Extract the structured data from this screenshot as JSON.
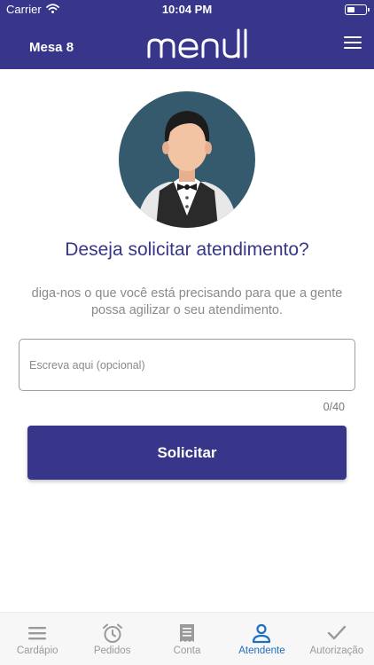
{
  "status_bar": {
    "carrier": "Carrier",
    "time": "10:04 PM"
  },
  "header": {
    "table": "Mesa 8",
    "logo_text": "menu",
    "menu_icon": "hamburger-icon"
  },
  "main": {
    "avatar_icon": "waiter-avatar",
    "title": "Deseja solicitar atendimento?",
    "subtitle": "diga-nos o que você está precisando para que a gente possa agilizar o seu atendimento.",
    "input_placeholder": "Escreva aqui (opcional)",
    "input_value": "",
    "counter": "0/40",
    "submit_label": "Solicitar"
  },
  "tabbar": {
    "active_color": "#1f6fc0",
    "items": [
      {
        "label": "Cardápio",
        "icon": "list-icon"
      },
      {
        "label": "Pedidos",
        "icon": "alarm-clock-icon"
      },
      {
        "label": "Conta",
        "icon": "receipt-icon"
      },
      {
        "label": "Atendente",
        "icon": "person-icon",
        "active": true
      },
      {
        "label": "Autorização",
        "icon": "checkmark-icon"
      }
    ]
  },
  "colors": {
    "brand": "#37368a",
    "tab_inactive": "#9a9a9a",
    "subtitle": "#8a8a8a"
  }
}
